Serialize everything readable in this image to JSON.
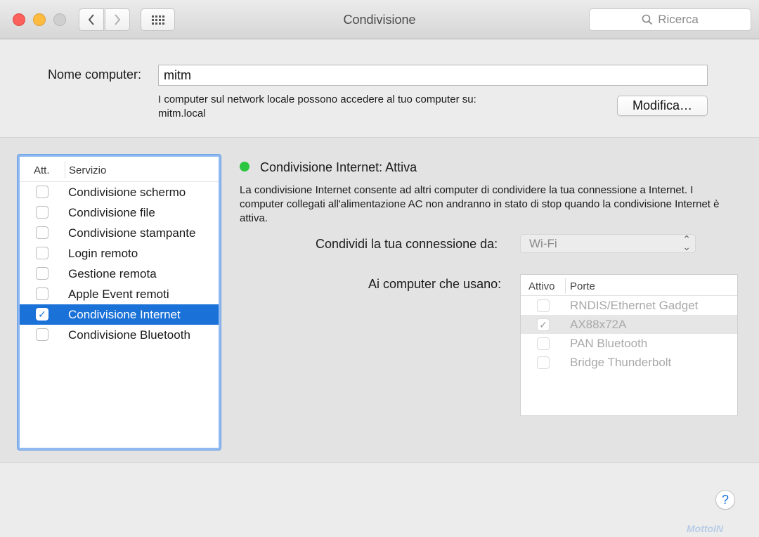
{
  "window": {
    "title": "Condivisione",
    "search_placeholder": "Ricerca"
  },
  "computer_name": {
    "label": "Nome computer:",
    "value": "mitm",
    "note_line1": "I computer sul network locale possono accedere al tuo computer su:",
    "note_line2": "mitm.local",
    "edit_button": "Modifica…"
  },
  "services": {
    "header_on": "Att.",
    "header_service": "Servizio",
    "items": [
      {
        "label": "Condivisione schermo",
        "checked": false,
        "selected": false
      },
      {
        "label": "Condivisione file",
        "checked": false,
        "selected": false
      },
      {
        "label": "Condivisione stampante",
        "checked": false,
        "selected": false
      },
      {
        "label": "Login remoto",
        "checked": false,
        "selected": false
      },
      {
        "label": "Gestione remota",
        "checked": false,
        "selected": false
      },
      {
        "label": "Apple Event remoti",
        "checked": false,
        "selected": false
      },
      {
        "label": "Condivisione Internet",
        "checked": true,
        "selected": true
      },
      {
        "label": "Condivisione Bluetooth",
        "checked": false,
        "selected": false
      }
    ]
  },
  "detail": {
    "status": "Condivisione Internet: Attiva",
    "status_color": "#2bc640",
    "description": "La condivisione Internet consente ad altri computer di condividere la tua connessione a Internet. I computer collegati all'alimentazione AC non andranno in stato di stop quando la condivisione Internet è attiva.",
    "share_from_label": "Condividi la tua connessione da:",
    "share_from_value": "Wi-Fi",
    "to_computers_label": "Ai computer che usano:",
    "ports_header_on": "Attivo",
    "ports_header_ports": "Porte",
    "ports": [
      {
        "label": "RNDIS/Ethernet Gadget",
        "checked": false,
        "selected": false
      },
      {
        "label": "AX88x72A",
        "checked": true,
        "selected": true
      },
      {
        "label": "PAN Bluetooth",
        "checked": false,
        "selected": false
      },
      {
        "label": "Bridge Thunderbolt",
        "checked": false,
        "selected": false
      }
    ]
  },
  "help_label": "?",
  "watermark": "MottoIN",
  "colors": {
    "selection": "#1a71d8",
    "focus_ring": "#8fb9f0"
  }
}
